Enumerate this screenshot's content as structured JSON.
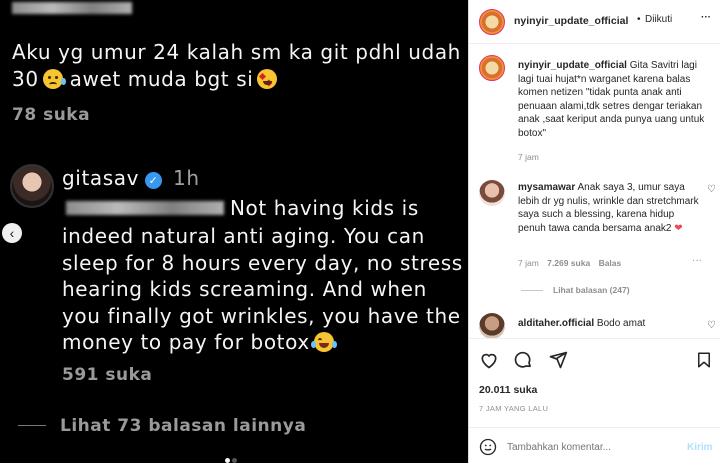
{
  "media": {
    "comment1": {
      "line1": "Aku yg umur 24 kalah sm ka git pdhl udah",
      "line2_a": "30",
      "line2_b": "awet muda bgt si",
      "likes": "78 suka"
    },
    "comment2": {
      "username": "gitasav",
      "time": "1h",
      "line1_suffix": "Not having kids is",
      "line2": "indeed natural anti aging. You can",
      "line3": "sleep for 8 hours every day, no stress",
      "line4": "hearing kids screaming. And when",
      "line5": "you finally got wrinkles, you have the",
      "line6": "money to pay for botox",
      "likes": "591 suka",
      "view_replies": "Lihat 73 balasan lainnya"
    }
  },
  "sidebar": {
    "header": {
      "username": "nyinyir_update_official",
      "separator": "•",
      "follow_status": "Diikuti",
      "more": "···"
    },
    "caption": {
      "username": "nyinyir_update_official",
      "text": "Gita Savitri lagi lagi tuai hujat*n warganet karena balas komen netizen \"tidak punta anak anti penuaan alami,tdk setres dengar teriakan anak ,saat keriput anda punya uang untuk botox\"",
      "time": "7 jam"
    },
    "comments": [
      {
        "username": "mysamawar",
        "text": "Anak saya 3, umur saya lebih dr yg nulis, wrinkle dan stretchmark saya such a blessing, karena hidup penuh tawa canda bersama anak2",
        "time": "7 jam",
        "likes": "7.269 suka",
        "reply": "Balas",
        "view_replies": "Lihat balasan (247)"
      },
      {
        "username": "alditaher.official",
        "text": "Bodo amat"
      }
    ],
    "likes_count": "20.011 suka",
    "posted_ago": "7 JAM YANG LALU",
    "comment_placeholder": "Tambahkan komentar...",
    "post_button": "Kirim"
  },
  "colors": {
    "verified": "#3897f0",
    "heart": "#ed4956",
    "post_button": "#b2dffc"
  }
}
